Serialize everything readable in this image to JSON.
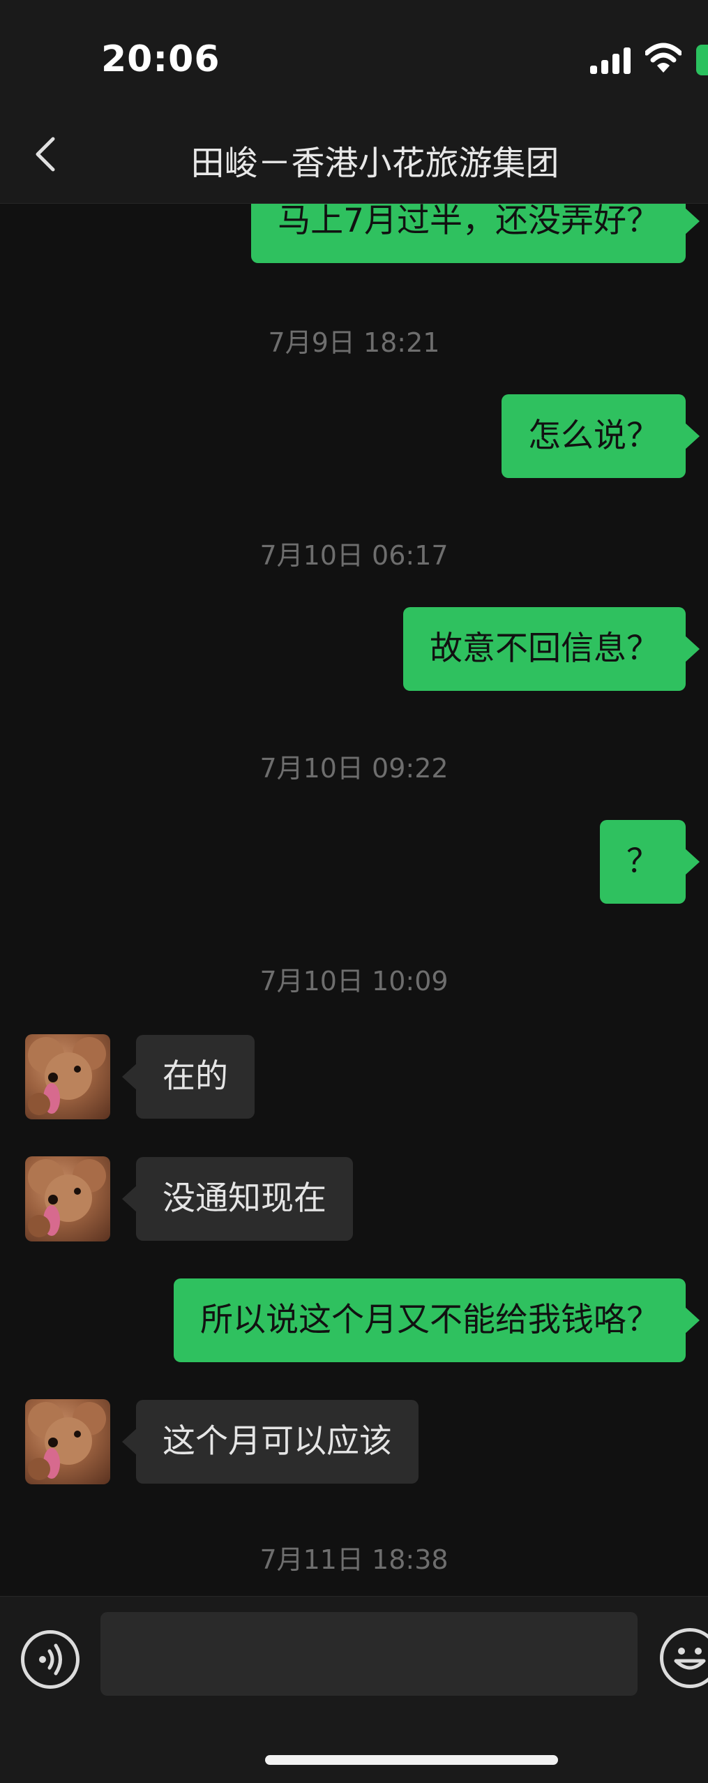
{
  "status_bar": {
    "time": "20:06"
  },
  "nav": {
    "title": "田峻－香港小花旅游集团"
  },
  "messages": [
    {
      "type": "sent",
      "text": "马上7月过半，还没弄好？"
    },
    {
      "type": "timestamp",
      "text": "7月9日 18:21"
    },
    {
      "type": "sent",
      "text": "怎么说？"
    },
    {
      "type": "timestamp",
      "text": "7月10日 06:17"
    },
    {
      "type": "sent",
      "text": "故意不回信息？"
    },
    {
      "type": "timestamp",
      "text": "7月10日 09:22"
    },
    {
      "type": "sent",
      "text": "？"
    },
    {
      "type": "timestamp",
      "text": "7月10日 10:09"
    },
    {
      "type": "received",
      "text": "在的"
    },
    {
      "type": "received",
      "text": "没通知现在"
    },
    {
      "type": "sent",
      "text": "所以说这个月又不能给我钱咯？"
    },
    {
      "type": "received",
      "text": "这个月可以应该"
    },
    {
      "type": "timestamp",
      "text": "7月11日 18:38"
    }
  ],
  "input": {
    "value": ""
  },
  "colors": {
    "sent_bubble": "#2fc15f",
    "received_bubble": "#2c2c2c",
    "background": "#111111"
  },
  "icons": {
    "back": "chevron-left-icon",
    "voice": "voice-icon",
    "emoji": "emoji-icon",
    "signal": "cellular-signal-icon",
    "wifi": "wifi-icon",
    "battery": "battery-icon"
  }
}
